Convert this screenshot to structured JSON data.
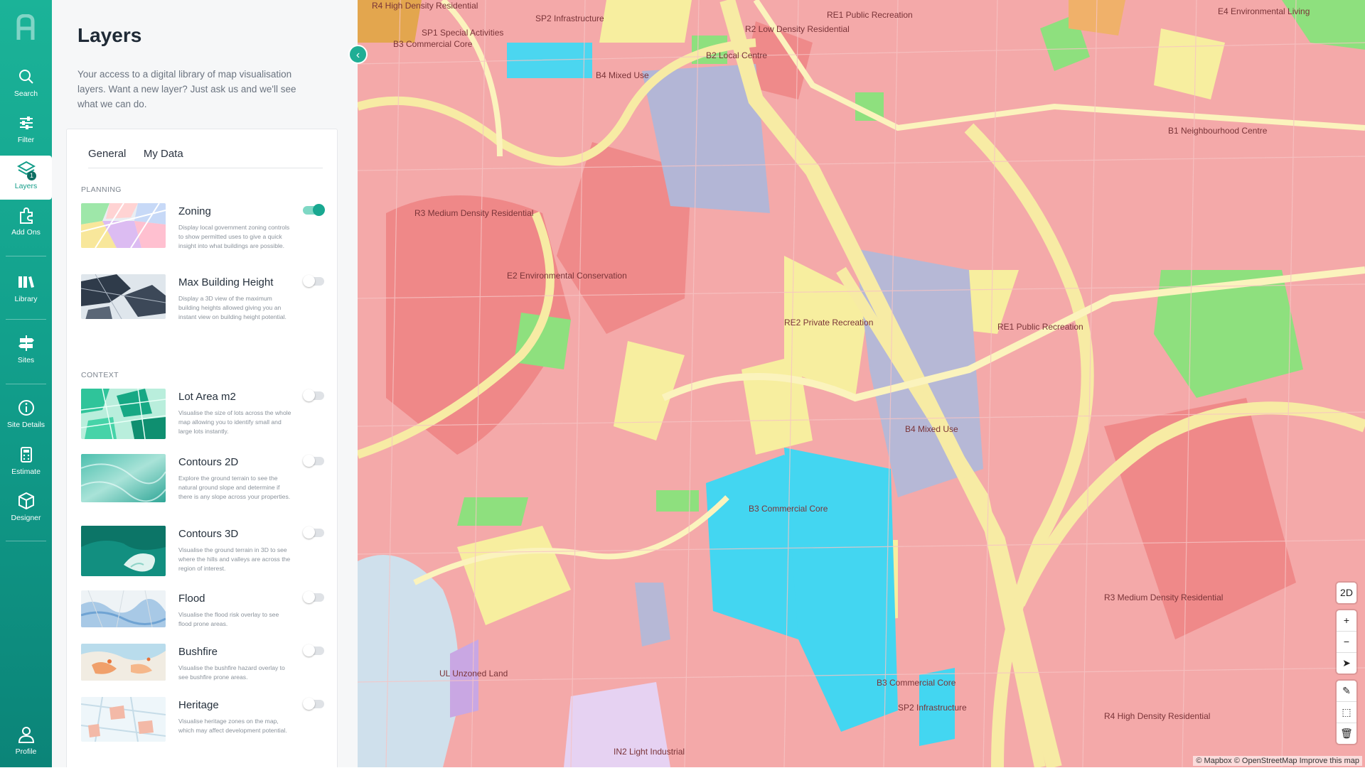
{
  "rail": {
    "items": [
      {
        "label": "Search",
        "icon": "search-icon"
      },
      {
        "label": "Filter",
        "icon": "sliders-icon"
      },
      {
        "label": "Layers",
        "icon": "layers-icon",
        "active": true,
        "badge": "1"
      },
      {
        "label": "Add Ons",
        "icon": "puzzle-icon"
      },
      {
        "label": "Library",
        "icon": "books-icon"
      },
      {
        "label": "Sites",
        "icon": "signpost-icon"
      },
      {
        "label": "Site Details",
        "icon": "info-icon"
      },
      {
        "label": "Estimate",
        "icon": "calculator-icon"
      },
      {
        "label": "Designer",
        "icon": "cube-icon"
      },
      {
        "label": "Profile",
        "icon": "user-icon"
      }
    ],
    "accent": "#139d89"
  },
  "panel": {
    "title": "Layers",
    "intro": "Your access to a digital library of map visualisation layers. Want a new layer? Just ask us and we'll see what we can do.",
    "tabs": [
      "General",
      "My Data"
    ],
    "sections": {
      "planning": "PLANNING",
      "context": "CONTEXT"
    },
    "layers": [
      {
        "title": "Zoning",
        "desc": "Display local government zoning controls to show permitted uses to give a quick insight into what buildings are possible.",
        "enabled": true
      },
      {
        "title": "Max Building Height",
        "desc": "Display a 3D view of the maximum building heights allowed giving you an instant view on building height potential.",
        "enabled": false
      },
      {
        "title": "Lot Area m2",
        "desc": "Visualise the size of lots across the whole map allowing you to identify small and large lots instantly.",
        "enabled": false
      },
      {
        "title": "Contours 2D",
        "desc": "Explore the ground terrain to see the natural ground slope and determine if there is any slope across your properties.",
        "enabled": false
      },
      {
        "title": "Contours 3D",
        "desc": "Visualise the ground terrain in 3D to see where the hills and valleys are across the region of interest.",
        "enabled": false
      },
      {
        "title": "Flood",
        "desc": "Visualise the flood risk overlay to see flood prone areas.",
        "enabled": false
      },
      {
        "title": "Bushfire",
        "desc": "Visualise the bushfire hazard overlay to see bushfire prone areas.",
        "enabled": false
      },
      {
        "title": "Heritage",
        "desc": "Visualise heritage zones on the map, which may affect development potential.",
        "enabled": false
      }
    ]
  },
  "map": {
    "controls": {
      "mode": "2D",
      "zoom_in": "+",
      "zoom_out": "−",
      "compass": "➤",
      "draw": "✎",
      "select": "⬚",
      "trash": "🗑"
    },
    "attribution": {
      "mapbox": "© Mapbox",
      "osm": "© OpenStreetMap",
      "improve": "Improve this map"
    },
    "zone_colors": {
      "residential": "#f2a3a3",
      "recreation": "#8ce27e",
      "infrastructure": "#f5eb97",
      "commercial": "#46d8f2",
      "mixed": "#b6b7d8",
      "road": "#fbf0a8"
    },
    "labels": [
      "R4 High Density Residential",
      "SP2 Infrastructure",
      "RE1 Public Recreation",
      "R2 Low Density Residential",
      "SP1 Special Activities",
      "B3 Commercial Core",
      "B4 Mixed Use",
      "R3 Medium Density Residential",
      "E2 Environmental Conservation",
      "B2 Local Centre",
      "B1 Neighbourhood Centre",
      "RE2 Private Recreation",
      "IN2 Light Industrial",
      "UL Unzoned Land",
      "E4 Environmental Living"
    ]
  }
}
